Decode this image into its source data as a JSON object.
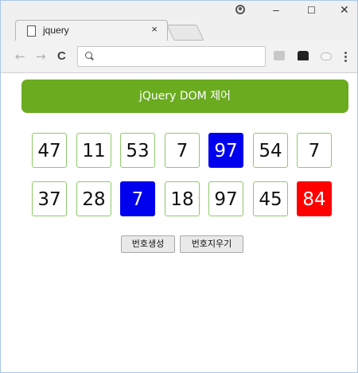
{
  "browser": {
    "tab_title": "jquery",
    "tab_close": "×",
    "window_controls": {
      "minimize": "–",
      "maximize": "☐",
      "close": "✕"
    },
    "nav": {
      "back": "←",
      "forward": "→",
      "reload": "C"
    },
    "address_value": ""
  },
  "page": {
    "banner_title": "jQuery DOM 제어",
    "accent_color": "#6aab1f",
    "numbers": [
      {
        "value": "47",
        "style": "normal"
      },
      {
        "value": "11",
        "style": "normal"
      },
      {
        "value": "53",
        "style": "normal"
      },
      {
        "value": "7",
        "style": "normal"
      },
      {
        "value": "97",
        "style": "blue"
      },
      {
        "value": "54",
        "style": "normal"
      },
      {
        "value": "7",
        "style": "normal"
      },
      {
        "value": "37",
        "style": "normal"
      },
      {
        "value": "28",
        "style": "normal"
      },
      {
        "value": "7",
        "style": "blue"
      },
      {
        "value": "18",
        "style": "normal"
      },
      {
        "value": "97",
        "style": "normal"
      },
      {
        "value": "45",
        "style": "normal"
      },
      {
        "value": "84",
        "style": "red"
      }
    ],
    "buttons": {
      "generate": "번호생성",
      "clear": "번호지우기"
    }
  }
}
